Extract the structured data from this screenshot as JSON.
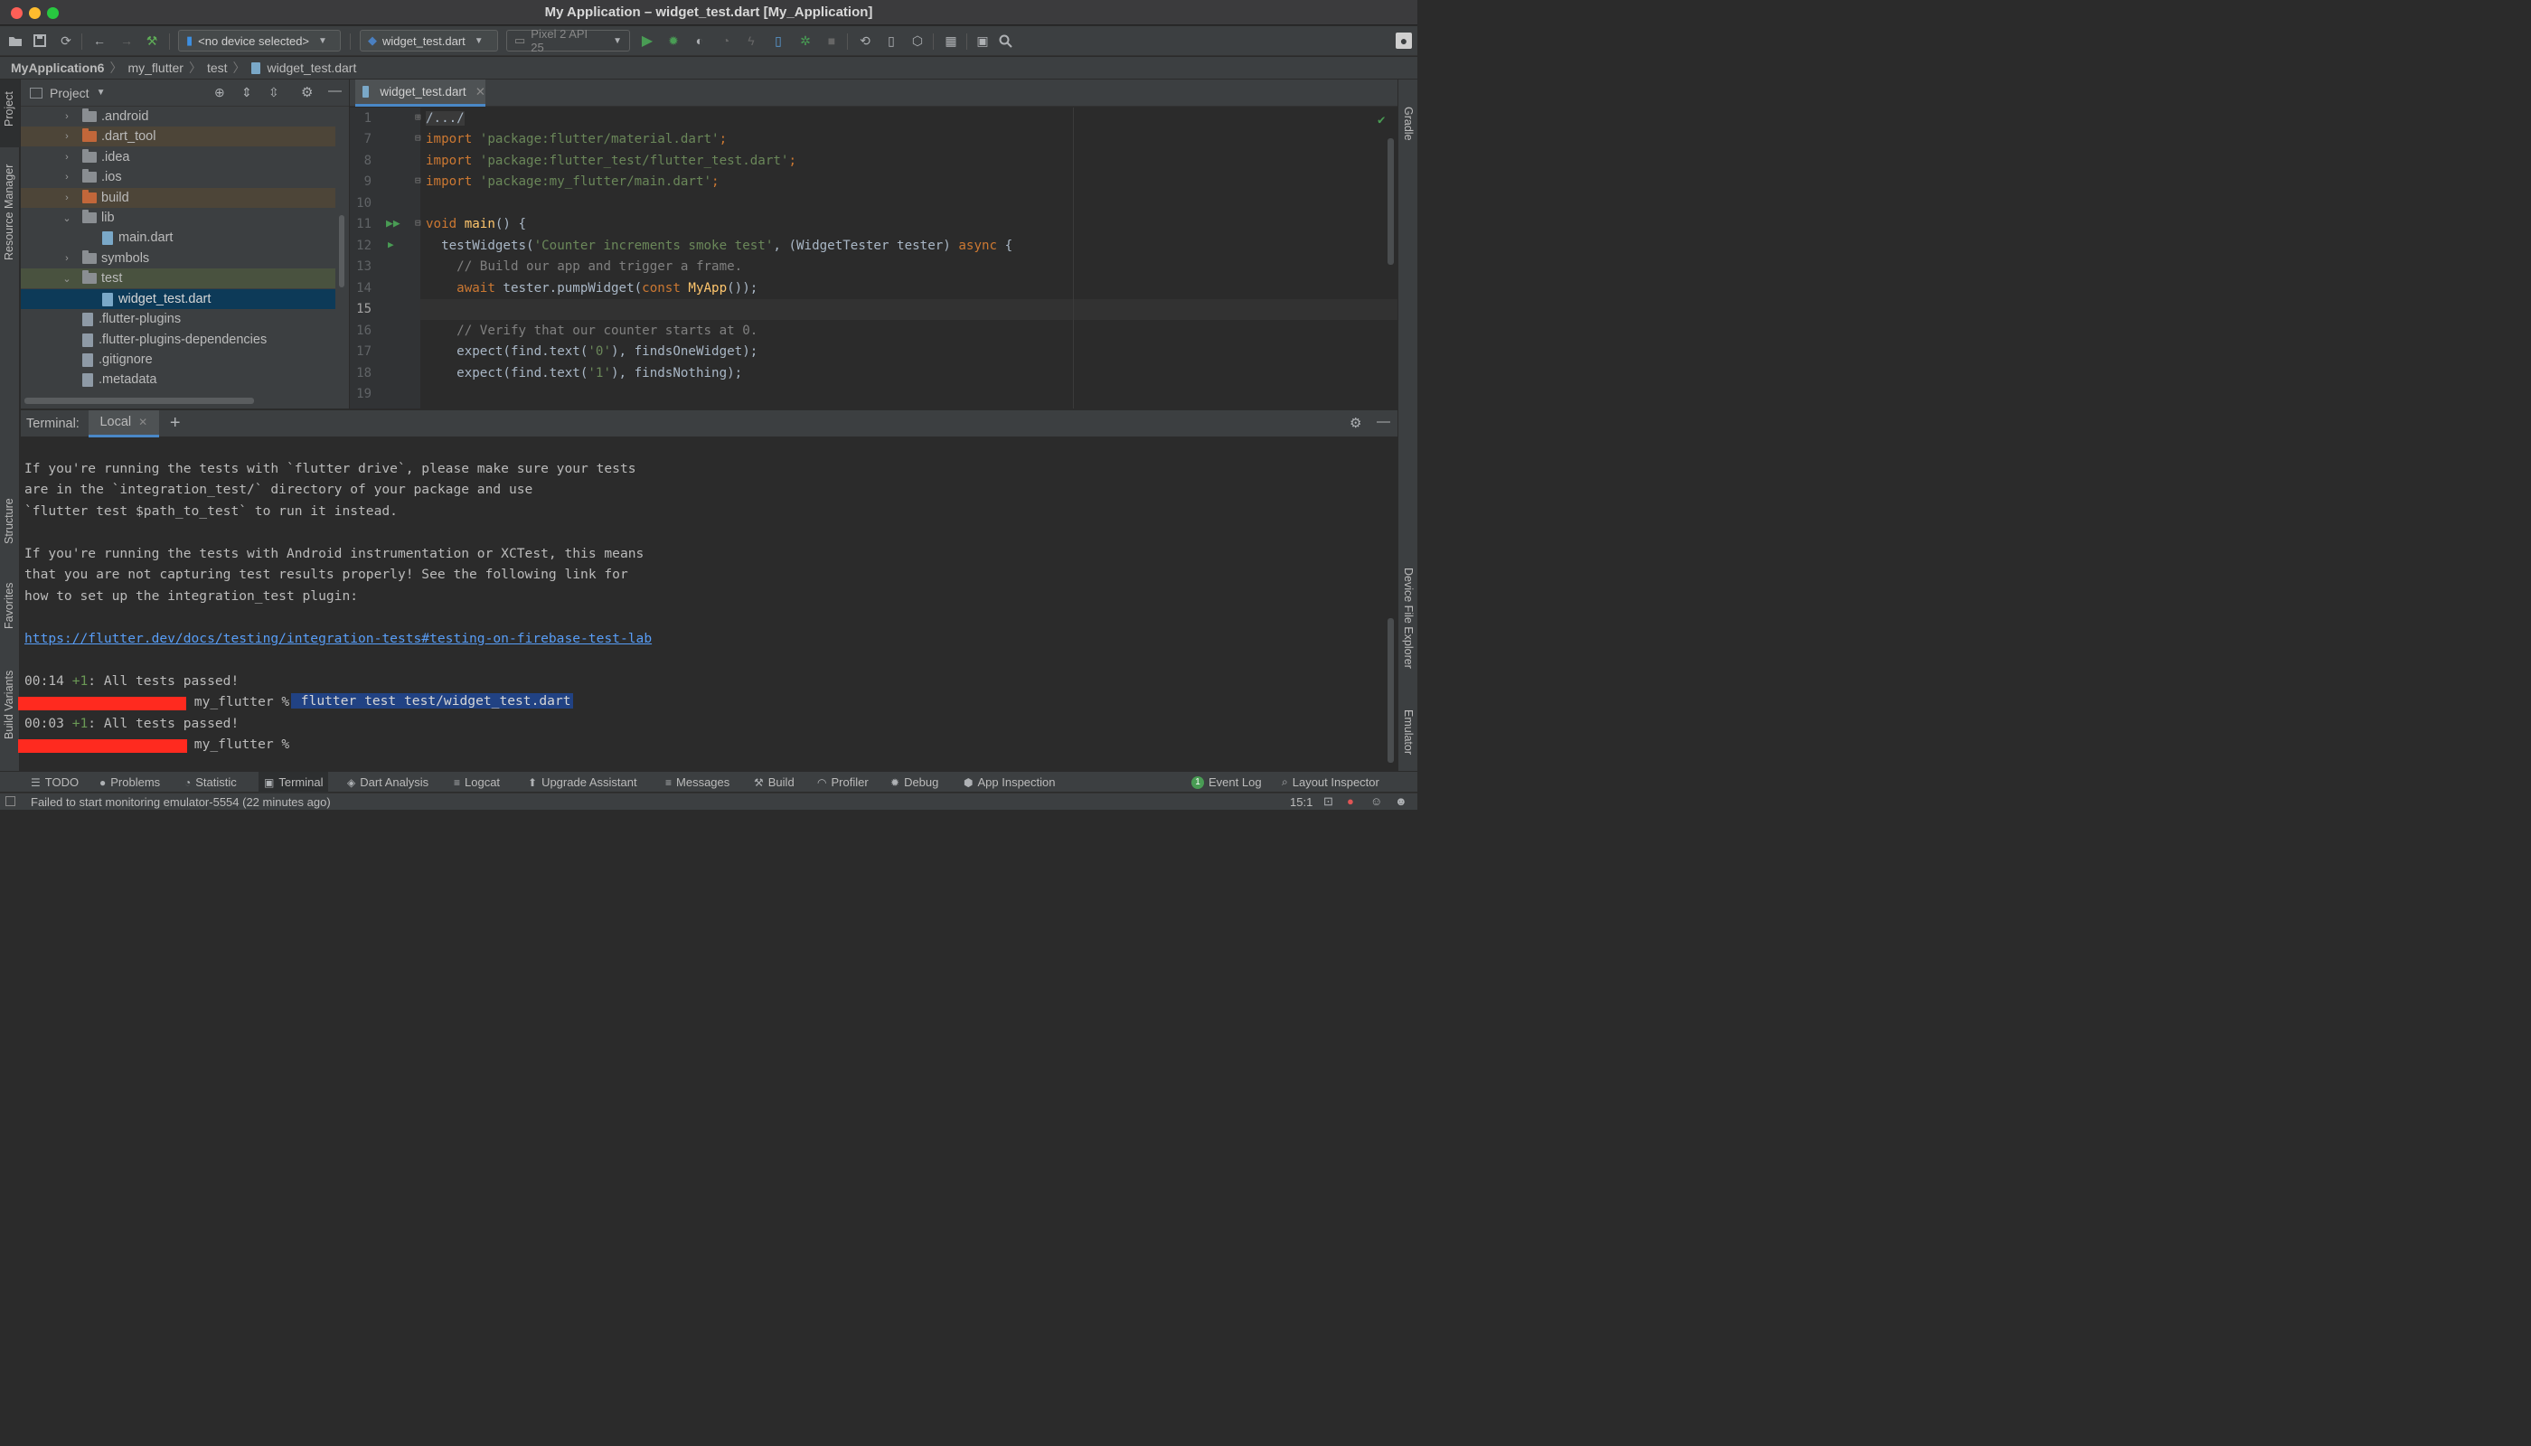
{
  "window": {
    "title": "My Application – widget_test.dart [My_Application]"
  },
  "toolbar": {
    "device_selector": "<no device selected>",
    "run_config": "widget_test.dart",
    "avd": "Pixel 2 API 25"
  },
  "breadcrumb": [
    "MyApplication6",
    "my_flutter",
    "test",
    "widget_test.dart"
  ],
  "left_stripe": {
    "project": "Project",
    "resource_manager": "Resource Manager",
    "structure": "Structure",
    "favorites": "Favorites",
    "build_variants": "Build Variants"
  },
  "right_stripe": {
    "gradle": "Gradle",
    "device_file_explorer": "Device File Explorer",
    "emulator": "Emulator"
  },
  "project_panel": {
    "title": "Project",
    "items": [
      {
        "label": ".android",
        "type": "folder"
      },
      {
        "label": ".dart_tool",
        "type": "folder-orange"
      },
      {
        "label": ".idea",
        "type": "folder"
      },
      {
        "label": ".ios",
        "type": "folder"
      },
      {
        "label": "build",
        "type": "folder-orange"
      },
      {
        "label": "lib",
        "type": "folder"
      },
      {
        "label": "main.dart",
        "type": "dart"
      },
      {
        "label": "symbols",
        "type": "folder"
      },
      {
        "label": "test",
        "type": "folder"
      },
      {
        "label": "widget_test.dart",
        "type": "dart"
      },
      {
        "label": ".flutter-plugins",
        "type": "file"
      },
      {
        "label": ".flutter-plugins-dependencies",
        "type": "file"
      },
      {
        "label": ".gitignore",
        "type": "file"
      },
      {
        "label": ".metadata",
        "type": "file"
      }
    ]
  },
  "editor": {
    "tab": "widget_test.dart",
    "line_numbers": [
      "1",
      "7",
      "8",
      "9",
      "10",
      "11",
      "12",
      "13",
      "14",
      "15",
      "16",
      "17",
      "18",
      "19"
    ],
    "lines": {
      "l1": "/.../",
      "l7a": "import ",
      "l7b": "'package:flutter/material.dart'",
      "l7c": ";",
      "l8a": "import ",
      "l8b": "'package:flutter_test/flutter_test.dart'",
      "l8c": ";",
      "l9a": "import ",
      "l9b": "'package:my_flutter/main.dart'",
      "l9c": ";",
      "l11a": "void ",
      "l11b": "main",
      "l11c": "() {",
      "l12a": "  testWidgets(",
      "l12b": "'Counter increments smoke test'",
      "l12c": ", (WidgetTester tester) ",
      "l12d": "async",
      "l12e": " {",
      "l13": "    // Build our app and trigger a frame.",
      "l14a": "    await ",
      "l14b": "tester.pumpWidget(",
      "l14c": "const ",
      "l14d": "MyApp",
      "l14e": "());",
      "l16": "    // Verify that our counter starts at 0.",
      "l17a": "    expect(find.text(",
      "l17b": "'0'",
      "l17c": "), findsOneWidget);",
      "l18a": "    expect(find.text(",
      "l18b": "'1'",
      "l18c": "), findsNothing);"
    }
  },
  "terminal": {
    "label": "Terminal:",
    "tab": "Local",
    "lines": [
      "If you're running the tests with `flutter drive`, please make sure your tests",
      "are in the `integration_test/` directory of your package and use",
      "`flutter test $path_to_test` to run it instead.",
      "If you're running the tests with Android instrumentation or XCTest, this means",
      "that you are not capturing test results properly! See the following link for",
      "how to set up the integration_test plugin:"
    ],
    "link": "https://flutter.dev/docs/testing/integration-tests#testing-on-firebase-test-lab",
    "result1_time": "00:14 ",
    "result1_count": "+1",
    "result1_msg": ": All tests passed!",
    "prompt": " my_flutter % ",
    "command": " flutter test test/widget_test.dart",
    "result2_time": "00:03 ",
    "result2_count": "+1",
    "result2_msg": ": All tests passed!",
    "prompt2": " my_flutter %"
  },
  "bottom_tools": {
    "todo": "TODO",
    "problems": "Problems",
    "statistic": "Statistic",
    "terminal": "Terminal",
    "dart_analysis": "Dart Analysis",
    "logcat": "Logcat",
    "upgrade_assistant": "Upgrade Assistant",
    "messages": "Messages",
    "build": "Build",
    "profiler": "Profiler",
    "debug": "Debug",
    "app_inspection": "App Inspection",
    "event_log_count": "1",
    "event_log": "Event Log",
    "layout_inspector": "Layout Inspector"
  },
  "status": {
    "message": "Failed to start monitoring emulator-5554 (22 minutes ago)",
    "position": "15:1"
  },
  "colors": {
    "accent": "#4a88c7",
    "selection": "#0d3a58",
    "redacted": "#ff2a1f",
    "run_green": "#499c54"
  }
}
